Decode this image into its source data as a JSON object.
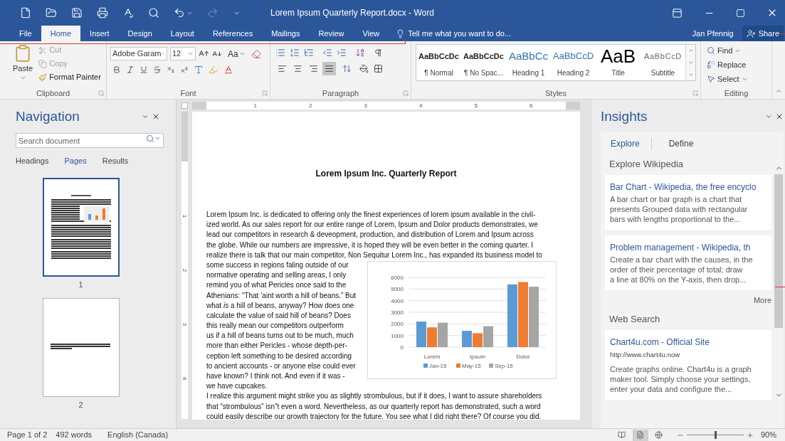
{
  "window": {
    "title": "Lorem Ipsum Quarterly Report.docx - Word"
  },
  "quick_access": [
    {
      "kind": "new",
      "disabled": false
    },
    {
      "kind": "open",
      "disabled": false
    },
    {
      "kind": "save",
      "disabled": false
    },
    {
      "kind": "print",
      "disabled": false
    },
    {
      "kind": "spelling",
      "disabled": false
    },
    {
      "kind": "find",
      "disabled": false
    },
    {
      "kind": "undo",
      "disabled": false
    },
    {
      "kind": "redo",
      "disabled": true
    },
    {
      "kind": "customize",
      "disabled": false
    }
  ],
  "tabs": [
    {
      "label": "File",
      "selected": false
    },
    {
      "label": "Home",
      "selected": true
    },
    {
      "label": "Insert",
      "selected": false
    },
    {
      "label": "Design",
      "selected": false
    },
    {
      "label": "Layout",
      "selected": false
    },
    {
      "label": "References",
      "selected": false
    },
    {
      "label": "Mailings",
      "selected": false
    },
    {
      "label": "Review",
      "selected": false
    },
    {
      "label": "View",
      "selected": false
    }
  ],
  "tell_me": {
    "placeholder": "Tell me what you want to do..."
  },
  "user": "Jan Pfennig",
  "share": "Share",
  "ribbon": {
    "clipboard": {
      "label": "Clipboard",
      "paste": "Paste",
      "items": [
        {
          "kind": "cut",
          "label": "Cut",
          "disabled": true
        },
        {
          "kind": "copy",
          "label": "Copy",
          "disabled": true
        },
        {
          "kind": "format_painter",
          "label": "Format Painter",
          "disabled": false
        }
      ]
    },
    "font": {
      "label": "Font",
      "font_name": "Adobe Garam",
      "font_size": "12",
      "change_case": "Aa"
    },
    "paragraph": {
      "label": "Paragraph",
      "alignment": [
        {
          "kind": "left",
          "selected": false
        },
        {
          "kind": "center",
          "selected": false
        },
        {
          "kind": "right",
          "selected": false
        },
        {
          "kind": "justify",
          "selected": true
        }
      ]
    },
    "styles": {
      "label": "Styles",
      "items": [
        {
          "kind": "normal",
          "preview": "AaBbCcDc",
          "name": "¶ Normal"
        },
        {
          "kind": "normal",
          "preview": "AaBbCcDc",
          "name": "¶ No Spac..."
        },
        {
          "kind": "heading1",
          "preview": "AaBbCc",
          "name": "Heading 1"
        },
        {
          "kind": "heading2",
          "preview": "AaBbCcD",
          "name": "Heading 2"
        },
        {
          "kind": "title",
          "preview": "AaB",
          "name": "Title"
        },
        {
          "kind": "subtitle",
          "preview": "AaBbCcD",
          "name": "Subtitle"
        }
      ]
    },
    "editing": {
      "label": "Editing",
      "items": [
        {
          "kind": "find",
          "label": "Find"
        },
        {
          "kind": "replace",
          "label": "Replace"
        },
        {
          "kind": "select",
          "label": "Select"
        }
      ]
    }
  },
  "navigation": {
    "title": "Navigation",
    "search": {
      "placeholder": "Search document"
    },
    "tabs": [
      {
        "label": "Headings",
        "selected": false
      },
      {
        "label": "Pages",
        "selected": true
      },
      {
        "label": "Results",
        "selected": false
      }
    ],
    "pages": [
      {
        "label": "1",
        "kind": "text_chart",
        "selected": true
      },
      {
        "label": "2",
        "kind": "text",
        "selected": false
      }
    ]
  },
  "document": {
    "ruler": [
      "1",
      "2",
      "3",
      "4",
      "5",
      "6"
    ],
    "vertical_ruler": [
      "1",
      "2",
      "3",
      "4"
    ],
    "title": "Lorem Ipsum Inc. Quarterly Report",
    "intro_lines": [
      "Lorem Ipsum Inc. is dedicated to offering only the finest experiences of lorem ipsum available in the civil-",
      "ized world.  As our sales report for our entire range of Lorem, Ipsum and Dolor products demonstrates, we",
      "lead our competitors in research & deveopment, production, and distribution of Lorem and Ipsum across",
      "the globe.  While our numbers are impressive, it is hoped they will be even better in the coming quarter.  I",
      "realize there is talk that our main competitor, Non Sequitur Lorem Inc., has expanded its business model to"
    ],
    "wrap_lines": [
      "some success in regions faling outside of our",
      "normative operating and selling areas, I only",
      "remind you of what Pericles once said to the",
      "Athenians: “That ’aint worth a hill of beans.” But",
      "what *is* a hill of beans, anyway?  How does one",
      "calculate the value of said hill of beans?  Does",
      "this really mean our competitors outperform",
      "us if a hill of beans turns out to be much, much",
      "more than either Pericles - whose depth-per-",
      "ception left something to be desired according",
      "to ancient accounts - or anyone else could ever",
      "have known?  I think not.  And even if it was -",
      "we have cupcakes."
    ],
    "closing_lines": [
      "I realize this argument might strike you as slightly strombulous, but if it does, I want to assure shareholders",
      "that “strombulous” isn”t even a word.  Nevertheless, as our quarterly report has demonstrated, such a word",
      "could easily describe our growth trajectory for the future.  You see what I did right there?  Of course you did."
    ],
    "chart": {
      "chart_data": {
        "type": "bar",
        "categories": [
          "Lorem",
          "Ipsum",
          "Dolor"
        ],
        "series": [
          {
            "name": "Jan-15",
            "color": "#5b9bd5",
            "values": [
              2200,
              1400,
              5400
            ]
          },
          {
            "name": "May-15",
            "color": "#ed7d31",
            "values": [
              1700,
              1200,
              5600
            ]
          },
          {
            "name": "Sep-15",
            "color": "#a5a5a5",
            "values": [
              2100,
              1800,
              5200
            ]
          }
        ],
        "ylim": [
          0,
          6000
        ],
        "yticks": [
          0,
          1000,
          2000,
          3000,
          4000,
          5000,
          6000
        ],
        "legend": "bottom",
        "grid": true
      }
    }
  },
  "insights": {
    "title": "Insights",
    "tabs": [
      {
        "label": "Explore",
        "selected": true
      },
      {
        "label": "Define",
        "selected": false
      }
    ],
    "wiki_heading": "Explore Wikipedia",
    "wiki_results": [
      {
        "title": "Bar Chart - Wikipedia, the free encyclo",
        "snippet": [
          "A bar chart or bar graph is a chart that",
          "presents Grouped data with rectangular",
          "bars with lengths proportional to the..."
        ]
      },
      {
        "title": "Problem management - Wikipedia, th",
        "snippet": [
          "Create a bar chart with the causes, in the",
          "order of their percentage of total; draw",
          "a line at 80% on the Y-axis, then drop..."
        ]
      }
    ],
    "more": "More",
    "web_heading": "Web Search",
    "web_results": [
      {
        "title": "Chart4u.com - Official Site",
        "url": "http://www.chart4u.now",
        "snippet": [
          "Create graphs online. Chart4u is a graph",
          "maker tool. Simply choose your settings,",
          "enter your data and configure the..."
        ]
      }
    ]
  },
  "status_bar": {
    "page": "Page 1 of 2",
    "words": "492 words",
    "language": "English (Canada)",
    "views": [
      {
        "kind": "read",
        "selected": false
      },
      {
        "kind": "print",
        "selected": true
      },
      {
        "kind": "web",
        "selected": false
      }
    ],
    "zoom": {
      "level": 0.5,
      "reading": "90%"
    }
  }
}
